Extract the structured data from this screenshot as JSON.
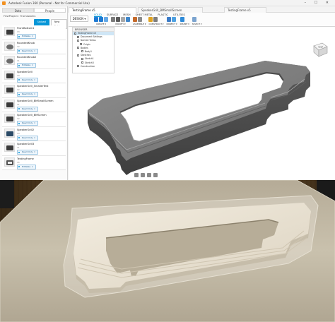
{
  "window": {
    "title": "Autodesk Fusion 360 (Personal - Not for Commercial Use)",
    "controls": "– ☐ ✕"
  },
  "data_panel": {
    "tabs": [
      "Data",
      "People"
    ],
    "breadcrumb": "FirstProject › Frameworks",
    "buttons": {
      "upload": "Upload",
      "new_folder": "New Folder"
    },
    "items": [
      {
        "name": "FrontBottom1",
        "version": "V3",
        "tag": "Editable",
        "thumb": "dark"
      },
      {
        "name": "RoundedKnob",
        "version": "V2",
        "tag": "Read Only",
        "thumb": "grey"
      },
      {
        "name": "RoundedKnob2",
        "version": "V1",
        "tag": "Editable",
        "thumb": "grey"
      },
      {
        "name": "SpeakerGrill",
        "version": "V4",
        "tag": "Read Only",
        "thumb": "dark"
      },
      {
        "name": "SpeakerGrill_SmallerTest",
        "version": "V2",
        "tag": "Read Only",
        "thumb": "dark"
      },
      {
        "name": "SpeakerGrill_BMSmallScreen",
        "version": "V1",
        "tag": "Read Only",
        "thumb": "dark"
      },
      {
        "name": "SpeakerGrill_BMScreen",
        "version": "V2",
        "tag": "Read Only",
        "thumb": "dark"
      },
      {
        "name": "SpeakerGrill2",
        "version": "V3",
        "tag": "Read Only",
        "thumb": "blue"
      },
      {
        "name": "SpeakerGrill3",
        "version": "V1",
        "tag": "Read Only",
        "thumb": "dark"
      },
      {
        "name": "TestingFrame",
        "version": "V5",
        "tag": "Editable",
        "thumb": "frame"
      }
    ]
  },
  "doc_tabs": [
    "TestingFrame v5",
    "SpeakerGrill_BMSmallScreen",
    "TestingFrame v5"
  ],
  "toolbar": {
    "workspace": "DESIGN ▾",
    "tabs": [
      "SOLID",
      "SURFACE",
      "MESH",
      "SHEET METAL",
      "PLASTIC",
      "UTILITIES"
    ],
    "groups": [
      {
        "label": "CREATE ▾",
        "colors": [
          "#1f7ad3",
          "#1f7ad3",
          "#63a8e6"
        ]
      },
      {
        "label": "MODIFY ▾",
        "colors": [
          "#7b7b7b",
          "#5c5c5c",
          "#a9a9a9",
          "#3f86c9"
        ]
      },
      {
        "label": "ASSEMBLE ▾",
        "colors": [
          "#c46a2b",
          "#8a8a8a"
        ]
      },
      {
        "label": "CONSTRUCT ▾",
        "colors": [
          "#e0a321",
          "#7e7e7e"
        ]
      },
      {
        "label": "INSPECT ▾",
        "colors": [
          "#3b7bc7",
          "#4ea0e0"
        ]
      },
      {
        "label": "INSERT ▾",
        "colors": [
          "#2e8ad8"
        ]
      },
      {
        "label": "SELECT ▾",
        "colors": [
          "#7ca4cf"
        ]
      }
    ]
  },
  "browser": {
    "title": "BROWSER",
    "rows": [
      "TestingFrame v5",
      "Document Settings",
      "Named Views",
      "Origin",
      "Bodies",
      "Body1",
      "Sketches",
      "Sketch1",
      "Sketch3",
      "Construction"
    ]
  },
  "viewcube": {
    "label": "TOP"
  }
}
